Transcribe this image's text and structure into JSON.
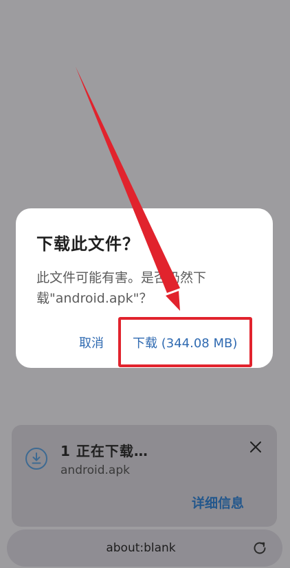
{
  "dialog": {
    "title": "下载此文件？",
    "message": "此文件可能有害。是否仍然下载\"android.apk\"？",
    "cancel_label": "取消",
    "download_label": "下载 (344.08 MB)"
  },
  "download_bar": {
    "title": "1 正在下载…",
    "filename": "android.apk",
    "details_label": "详细信息",
    "icon": "download-icon",
    "close_icon": "close-icon"
  },
  "address_bar": {
    "url": "about:blank",
    "reload_icon": "reload-icon"
  },
  "colors": {
    "overlay": "#9d9c9f",
    "dialog_bg": "#ffffff",
    "accent": "#2f6ab1",
    "annotation": "#e1232d"
  }
}
